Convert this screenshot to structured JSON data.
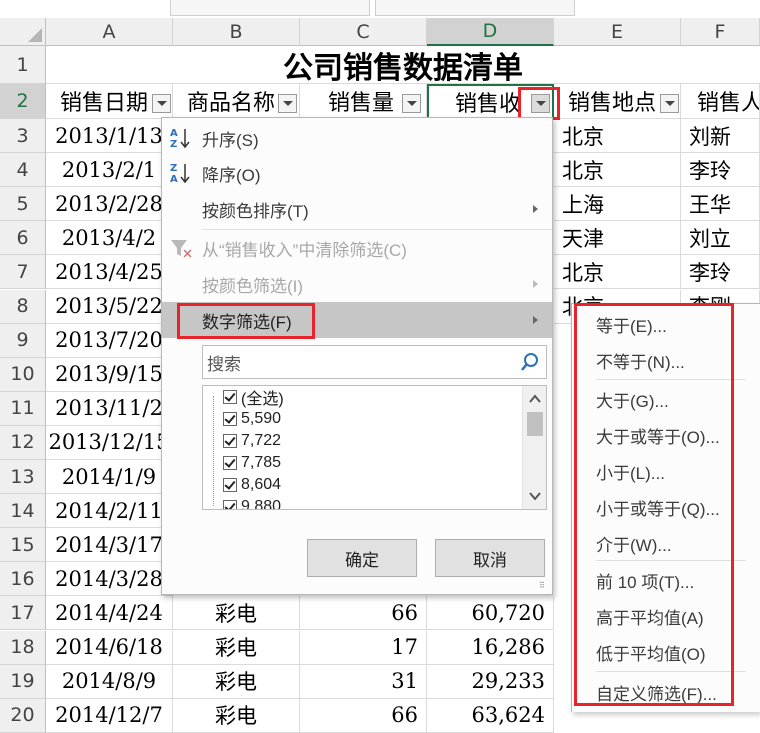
{
  "columns": [
    "A",
    "B",
    "C",
    "D",
    "E",
    "F"
  ],
  "rows": [
    "1",
    "2",
    "3",
    "4",
    "5",
    "6",
    "7",
    "8",
    "9",
    "10",
    "11",
    "12",
    "13",
    "14",
    "15",
    "16",
    "17",
    "18",
    "19",
    "20"
  ],
  "title": "公司销售数据清单",
  "headers": [
    "销售日期",
    "商品名称",
    "销售量",
    "销售收",
    "销售地点",
    "销售人"
  ],
  "col_a": [
    "2013/1/13",
    "2013/2/1",
    "2013/2/28",
    "2013/4/2",
    "2013/4/25",
    "2013/5/22",
    "2013/7/20",
    "2013/9/15",
    "2013/11/2",
    "2013/12/15",
    "2014/1/9",
    "2014/2/11",
    "2014/3/17",
    "2014/3/28",
    "2014/4/24",
    "2014/6/18",
    "2014/8/9",
    "2014/12/7"
  ],
  "col_e": [
    "北京",
    "北京",
    "上海",
    "天津",
    "北京",
    "北京"
  ],
  "col_f": [
    "刘新",
    "李玲",
    "王华",
    "刘立",
    "李玲",
    "李刚"
  ],
  "visible_rows": [
    {
      "b": "彩电",
      "c": "66",
      "d": "60,720"
    },
    {
      "b": "彩电",
      "c": "17",
      "d": "16,286"
    },
    {
      "b": "彩电",
      "c": "31",
      "d": "29,233"
    },
    {
      "b": "彩电",
      "c": "66",
      "d": "63,624"
    }
  ],
  "menu": {
    "sort_asc": "升序(S)",
    "sort_desc": "降序(O)",
    "sort_color": "按颜色排序(T)",
    "clear_filter": "从“销售收入”中清除筛选(C)",
    "filter_color": "按颜色筛选(I)",
    "number_filter": "数字筛选(F)",
    "search_placeholder": "搜索",
    "list": [
      "(全选)",
      "5,590",
      "7,722",
      "7,785",
      "8,604",
      "9,880"
    ],
    "ok": "确定",
    "cancel": "取消"
  },
  "submenu": [
    "等于(E)...",
    "不等于(N)...",
    "大于(G)...",
    "大于或等于(O)...",
    "小于(L)...",
    "小于或等于(Q)...",
    "介于(W)...",
    "前 10 项(T)...",
    "高于平均值(A)",
    "低于平均值(O)",
    "自定义筛选(F)..."
  ],
  "colors": {
    "highlight_red": "#e8232a",
    "selected_col": "#217346"
  }
}
